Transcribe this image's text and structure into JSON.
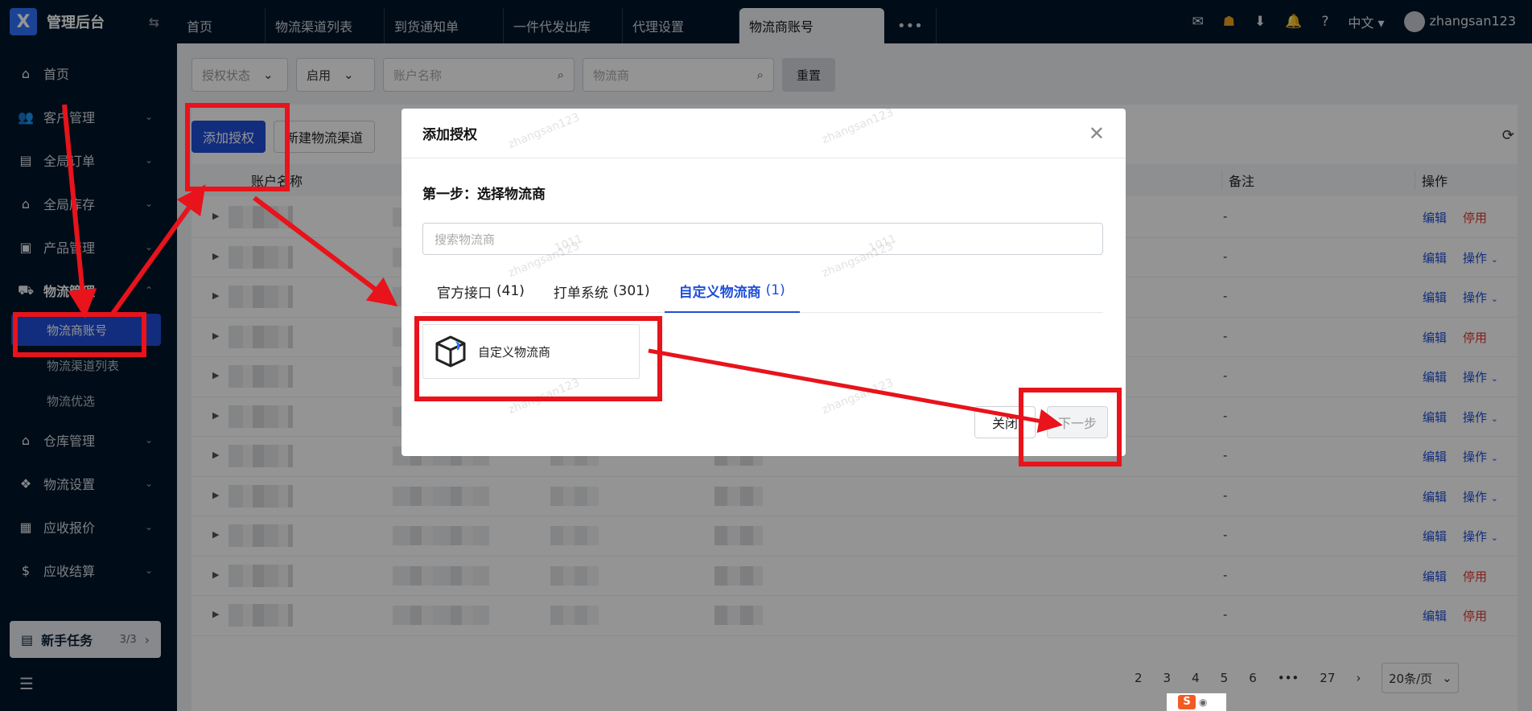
{
  "app": {
    "title": "管理后台",
    "logo_glyph": "X"
  },
  "sidebar": {
    "items": [
      {
        "label": "首页",
        "icon": "home-icon"
      },
      {
        "label": "客户管理",
        "icon": "users-icon"
      },
      {
        "label": "全局订单",
        "icon": "clipboard-icon"
      },
      {
        "label": "全局库存",
        "icon": "bank-icon"
      },
      {
        "label": "产品管理",
        "icon": "briefcase-icon"
      },
      {
        "label": "物流管理",
        "icon": "truck-icon"
      },
      {
        "label": "仓库管理",
        "icon": "warehouse-icon"
      },
      {
        "label": "物流设置",
        "icon": "cubes-icon"
      },
      {
        "label": "应收报价",
        "icon": "document-icon"
      },
      {
        "label": "应收结算",
        "icon": "dollar-icon"
      }
    ],
    "logistics_sub": [
      "物流商账号",
      "物流渠道列表",
      "物流优选"
    ],
    "task": {
      "label": "新手任务",
      "count": "3/3"
    }
  },
  "topbar": {
    "tabs": [
      "首页",
      "物流渠道列表",
      "到货通知单",
      "一件代发出库",
      "代理设置",
      "物流商账号"
    ],
    "language": "中文",
    "user": "zhangsan123"
  },
  "filters": {
    "auth_status_placeholder": "授权状态",
    "enabled_value": "启用",
    "account_placeholder": "账户名称",
    "carrier_placeholder": "物流商",
    "reset_label": "重置"
  },
  "toolbar": {
    "add_auth": "添加授权",
    "new_channel": "新建物流渠道"
  },
  "table": {
    "headers": {
      "name": "账户名称",
      "note": "备注",
      "op": "操作"
    },
    "rows": [
      {
        "note": "-",
        "edit": "编辑",
        "action": "停用",
        "action_type": "stop"
      },
      {
        "note": "-",
        "edit": "编辑",
        "action": "操作",
        "action_type": "more"
      },
      {
        "note": "-",
        "edit": "编辑",
        "action": "操作",
        "action_type": "more"
      },
      {
        "note": "-",
        "edit": "编辑",
        "action": "停用",
        "action_type": "stop"
      },
      {
        "note": "-",
        "edit": "编辑",
        "action": "操作",
        "action_type": "more"
      },
      {
        "note": "-",
        "edit": "编辑",
        "action": "操作",
        "action_type": "more"
      },
      {
        "note": "-",
        "edit": "编辑",
        "action": "操作",
        "action_type": "more"
      },
      {
        "note": "-",
        "edit": "编辑",
        "action": "操作",
        "action_type": "more"
      },
      {
        "note": "-",
        "edit": "编辑",
        "action": "操作",
        "action_type": "more"
      },
      {
        "note": "-",
        "edit": "编辑",
        "action": "停用",
        "action_type": "stop"
      },
      {
        "note": "-",
        "edit": "编辑",
        "action": "停用",
        "action_type": "stop"
      }
    ],
    "pagination": {
      "pages": [
        "2",
        "3",
        "4",
        "5",
        "6",
        "•••",
        "27"
      ],
      "page_size": "20条/页"
    }
  },
  "modal": {
    "title": "添加授权",
    "step_title": "第一步：选择物流商",
    "search_placeholder": "搜索物流商",
    "tabs": [
      {
        "label": "官方接口",
        "count": "(41)"
      },
      {
        "label": "打单系统",
        "count": "(301)"
      },
      {
        "label": "自定义物流商",
        "count": "(1)"
      }
    ],
    "carrier_name": "自定义物流商",
    "cancel_label": "关闭",
    "next_label": "下一步",
    "watermark": "zhangsan123",
    "watermark_id": "1011"
  },
  "colors": {
    "primary": "#1f4fd8",
    "danger": "#e0372e",
    "annotation": "#e8131b",
    "sidebar_bg": "#001529"
  }
}
